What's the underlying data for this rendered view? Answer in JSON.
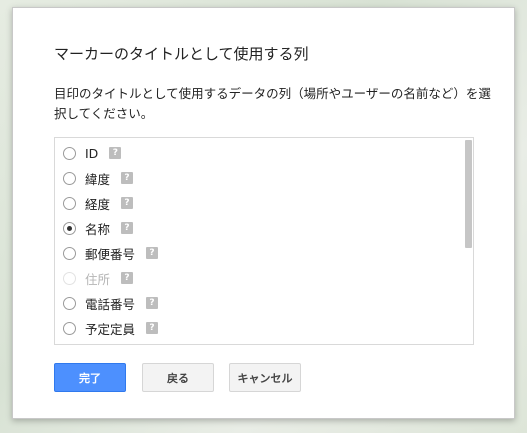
{
  "dialog": {
    "title": "マーカーのタイトルとして使用する列",
    "description": "目印のタイトルとして使用するデータの列（場所やユーザーの名前など）を選択してください。"
  },
  "columns": [
    {
      "label": "ID",
      "checked": false,
      "disabled": false
    },
    {
      "label": "緯度",
      "checked": false,
      "disabled": false
    },
    {
      "label": "経度",
      "checked": false,
      "disabled": false
    },
    {
      "label": "名称",
      "checked": true,
      "disabled": false
    },
    {
      "label": "郵便番号",
      "checked": false,
      "disabled": false
    },
    {
      "label": "住所",
      "checked": false,
      "disabled": true
    },
    {
      "label": "電話番号",
      "checked": false,
      "disabled": false
    },
    {
      "label": "予定定員",
      "checked": false,
      "disabled": false
    }
  ],
  "help_glyph": "?",
  "buttons": {
    "done": "完了",
    "back": "戻る",
    "cancel": "キャンセル"
  },
  "colors": {
    "primary": "#4d90fe",
    "primary_border": "#3079ed",
    "help_icon": "#bdbdbd"
  }
}
